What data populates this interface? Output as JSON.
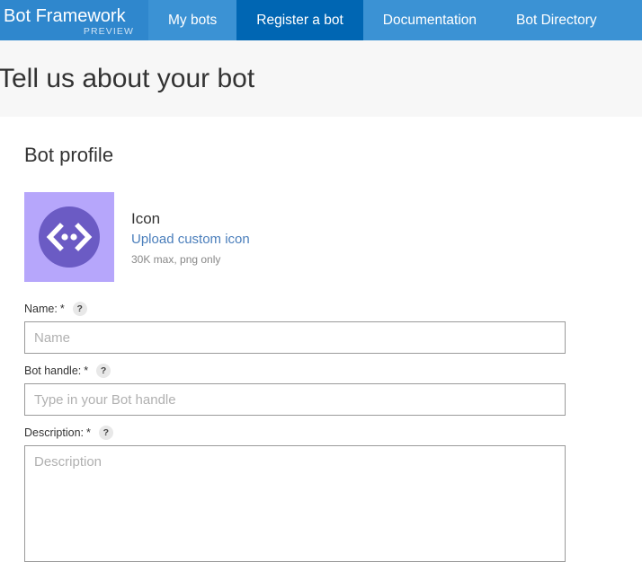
{
  "nav": {
    "brand": {
      "title": "Bot Framework",
      "subtitle": "PREVIEW"
    },
    "tabs": [
      {
        "label": "My bots",
        "active": false
      },
      {
        "label": "Register a bot",
        "active": true
      },
      {
        "label": "Documentation",
        "active": false
      },
      {
        "label": "Bot Directory",
        "active": false
      }
    ],
    "colors": {
      "bar": "#3b92d4",
      "brand_bg": "#2f87cd",
      "active_tab": "#0066b3",
      "text": "#ffffff",
      "subtitle": "#cfe3f4"
    }
  },
  "page": {
    "title": "Tell us about your bot",
    "header_bg": "#f7f7f7"
  },
  "section": {
    "title": "Bot profile"
  },
  "icon_block": {
    "avatar_icon": "code-brackets-icon",
    "avatar_bg": "#b6a6fb",
    "avatar_circle": "#6b5bc4",
    "label": "Icon",
    "upload_link": "Upload custom icon",
    "link_color": "#4a7ebb",
    "hint": "30K max, png only"
  },
  "form": {
    "help_icon": "?",
    "required_marker": "*",
    "fields": [
      {
        "label": "Name:",
        "value": "",
        "placeholder": "Name"
      },
      {
        "label": "Bot handle:",
        "value": "",
        "placeholder": "Type in your Bot handle"
      },
      {
        "label": "Description:",
        "value": "",
        "placeholder": "Description"
      }
    ]
  }
}
